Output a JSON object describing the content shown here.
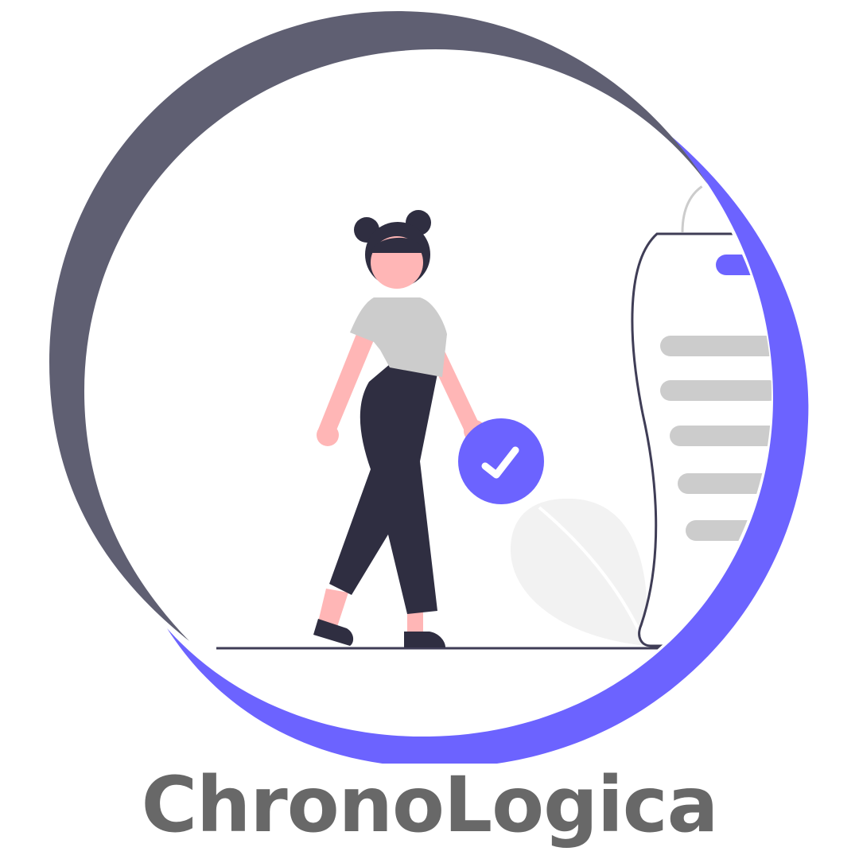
{
  "brand": {
    "name": "ChronoLogica"
  },
  "colors": {
    "ring_dark": "#5f5f72",
    "ring_accent": "#6c63ff",
    "figure_dark": "#2f2e41",
    "skin": "#ffb6b6",
    "shirt": "#cccccc",
    "leaf": "#f2f2f2",
    "list_bar": "#cccccc",
    "brand_text": "#686868"
  },
  "icons": {
    "check_badge": "check-circle-icon",
    "figure": "woman-walking-illustration",
    "document": "checklist-document-illustration",
    "plant": "leaf-illustration"
  }
}
